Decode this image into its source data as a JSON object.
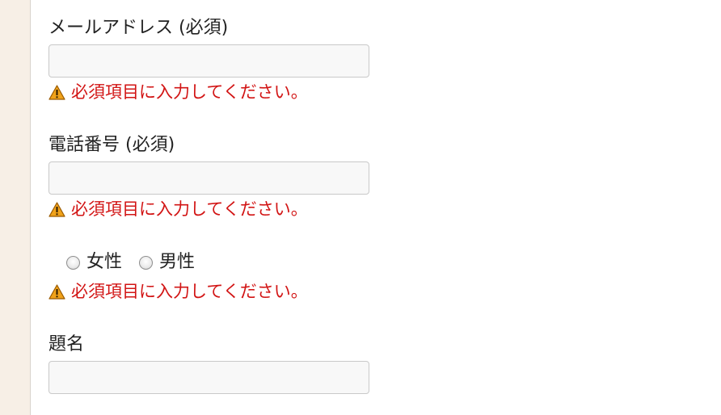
{
  "form": {
    "email": {
      "label": "メールアドレス (必須)",
      "value": "",
      "error": "必須項目に入力してください。"
    },
    "phone": {
      "label": "電話番号 (必須)",
      "value": "",
      "error": "必須項目に入力してください。"
    },
    "gender": {
      "options": [
        "女性",
        "男性"
      ],
      "selected": null,
      "error": "必須項目に入力してください。"
    },
    "subject": {
      "label": "題名",
      "value": ""
    }
  },
  "colors": {
    "error_text": "#d21414",
    "warning_icon": "#f0a21a",
    "sidebar_bg": "#f7efe6",
    "input_bg": "#f8f8f8",
    "input_border": "#c9c9c9"
  },
  "icons": {
    "warning": "warning-triangle-icon",
    "radio": "radio-unchecked"
  }
}
